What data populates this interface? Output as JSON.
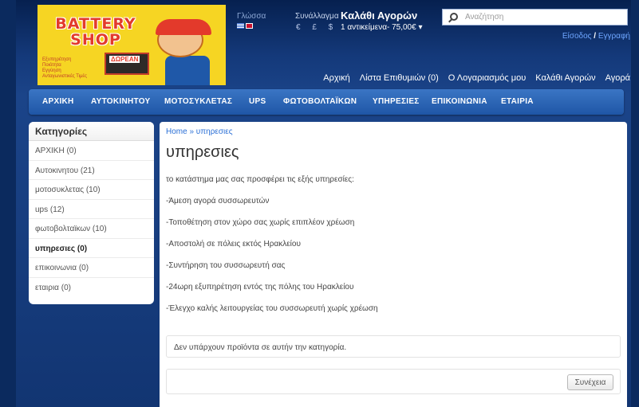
{
  "header": {
    "logo": {
      "title_line1": "BATTERY",
      "title_line2": "SHOP",
      "bullets": [
        "Εξυπηρέτηση",
        "Ποιότητα",
        "Εγγύηση",
        "Ανταγωνιστικές Τιμές"
      ],
      "badge": "ΔΩΡΕΑΝ"
    },
    "language": {
      "label": "Γλώσσα"
    },
    "currency": {
      "label": "Συνάλλαγμα",
      "symbols": "€ £ $"
    },
    "cart": {
      "title": "Καλάθι Αγορών",
      "summary": "1 αντικείμενα- 75,00€ ▾"
    },
    "search": {
      "placeholder": "Αναζήτηση"
    },
    "account": {
      "login": "Είσοδος",
      "separator": " / ",
      "register": "Εγγραφή"
    },
    "links": [
      {
        "label": "Αρχική"
      },
      {
        "label": "Λίστα Επιθυμιών (0)"
      },
      {
        "label": "Ο Λογαριασμός μου"
      },
      {
        "label": "Καλάθι Αγορών"
      },
      {
        "label": "Αγορά"
      }
    ]
  },
  "menu": [
    {
      "label": "ΑΡΧΙΚΗ"
    },
    {
      "label": "ΑΥΤΟΚΙΝΗΤΟΥ"
    },
    {
      "label": "ΜΟΤΟΣΥΚΛΕΤΑΣ"
    },
    {
      "label": "UPS"
    },
    {
      "label": "ΦΩΤΟΒΟΛΤΑΪΚΩΝ"
    },
    {
      "label": "ΥΠΗΡΕΣΙΕΣ"
    },
    {
      "label": "ΕΠΙΚΟΙΝΩΝΙΑ"
    },
    {
      "label": "ΕΤΑΙΡΙΑ"
    }
  ],
  "sidebar": {
    "title": "Κατηγορίες",
    "items": [
      {
        "label": "ΑΡΧΙΚΗ (0)"
      },
      {
        "label": "Αυτοκινητου (21)"
      },
      {
        "label": "μοτοσυκλετας (10)"
      },
      {
        "label": "ups (12)"
      },
      {
        "label": "φωτοβολταϊκων (10)"
      },
      {
        "label": "υπηρεσιες (0)",
        "active": true
      },
      {
        "label": "επικοινωνια (0)"
      },
      {
        "label": "εταιρια (0)"
      }
    ]
  },
  "content": {
    "breadcrumb": "Home » υπηρεσιες",
    "title": "υπηρεσιες",
    "paragraphs": [
      "το κατάστημα μας σας προσφέρει τις εξής υπηρεσίες:",
      "-Άμεση αγορά συσσωρευτών",
      "-Τοποθέτηση στον χώρο σας χωρίς επιπλέον χρέωση",
      "-Αποστολή σε πόλεις εκτός Ηρακλείου",
      "-Συντήρηση του συσσωρευτή σας",
      "-24ωρη εξυπηρέτηση εντός της πόλης του Ηρακλείου",
      "-Έλεγχο καλής λειτουργείας του συσσωρευτή χωρίς χρέωση"
    ],
    "empty_message": "Δεν υπάρχουν προϊόντα σε αυτήν την κατηγορία.",
    "continue_label": "Συνέχεια"
  }
}
